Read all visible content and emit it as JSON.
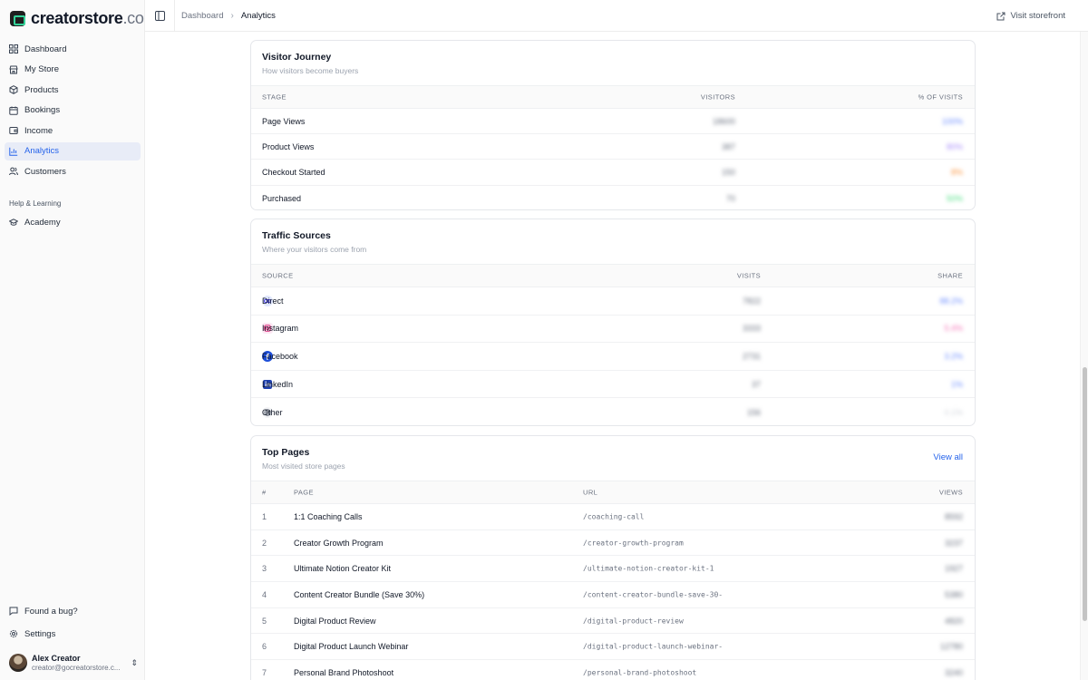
{
  "app": {
    "logo_main": "creatorstore",
    "logo_suffix": ".co"
  },
  "sidebar": {
    "items": [
      {
        "label": "Dashboard",
        "icon": "grid-icon"
      },
      {
        "label": "My Store",
        "icon": "store-icon"
      },
      {
        "label": "Products",
        "icon": "box-icon"
      },
      {
        "label": "Bookings",
        "icon": "calendar-icon"
      },
      {
        "label": "Income",
        "icon": "wallet-icon"
      },
      {
        "label": "Analytics",
        "icon": "bar-chart-icon",
        "active": true
      },
      {
        "label": "Customers",
        "icon": "users-icon"
      }
    ],
    "section_label": "Help & Learning",
    "help_items": [
      {
        "label": "Academy",
        "icon": "graduation-cap-icon"
      }
    ],
    "bottom_items": [
      {
        "label": "Found a bug?",
        "icon": "chat-icon"
      },
      {
        "label": "Settings",
        "icon": "gear-icon"
      }
    ],
    "user": {
      "name": "Alex Creator",
      "email": "creator@gocreatorstore.c..."
    }
  },
  "topbar": {
    "breadcrumb": [
      "Dashboard",
      "Analytics"
    ],
    "visit_label": "Visit storefront"
  },
  "visitor_journey": {
    "title": "Visitor Journey",
    "subtitle": "How visitors become buyers",
    "columns": [
      "STAGE",
      "VISITORS",
      "% OF VISITS"
    ],
    "rows": [
      {
        "stage": "Page Views",
        "visitors": "18600",
        "pct": "100%",
        "color": "#6b8cff"
      },
      {
        "stage": "Product Views",
        "visitors": "387",
        "pct": "80%",
        "color": "#a78bfa"
      },
      {
        "stage": "Checkout Started",
        "visitors": "150",
        "pct": "8%",
        "color": "#fb923c"
      },
      {
        "stage": "Purchased",
        "visitors": "70",
        "pct": "50%",
        "color": "#4ade80"
      }
    ]
  },
  "traffic_sources": {
    "title": "Traffic Sources",
    "subtitle": "Where your visitors come from",
    "columns": [
      "SOURCE",
      "VISITS",
      "SHARE"
    ],
    "rows": [
      {
        "source": "Direct",
        "icon": "link-icon",
        "visits": "7822",
        "share": "88.2%",
        "color": "#6b8cff"
      },
      {
        "source": "Instagram",
        "icon": "instagram-icon",
        "visits": "3333",
        "share": "5.4%",
        "color": "#f472b6"
      },
      {
        "source": "Facebook",
        "icon": "facebook-icon",
        "visits": "2731",
        "share": "3.2%",
        "color": "#6b8cff"
      },
      {
        "source": "LinkedIn",
        "icon": "linkedin-icon",
        "visits": "37",
        "share": "1%",
        "color": "#6b8cff"
      },
      {
        "source": "Other",
        "icon": "globe-icon",
        "visits": "156",
        "share": "0.1%",
        "color": "#d1d5db"
      }
    ]
  },
  "top_pages": {
    "title": "Top Pages",
    "subtitle": "Most visited store pages",
    "view_all": "View all",
    "columns": [
      "#",
      "PAGE",
      "URL",
      "VIEWS"
    ],
    "rows": [
      {
        "rank": "1",
        "page": "1:1 Coaching Calls",
        "url": "/coaching-call",
        "views": "8592"
      },
      {
        "rank": "2",
        "page": "Creator Growth Program",
        "url": "/creator-growth-program",
        "views": "3237"
      },
      {
        "rank": "3",
        "page": "Ultimate Notion Creator Kit",
        "url": "/ultimate-notion-creator-kit-1",
        "views": "1927"
      },
      {
        "rank": "4",
        "page": "Content Creator Bundle (Save 30%)",
        "url": "/content-creator-bundle-save-30-",
        "views": "5380"
      },
      {
        "rank": "5",
        "page": "Digital Product Review",
        "url": "/digital-product-review",
        "views": "4820"
      },
      {
        "rank": "6",
        "page": "Digital Product Launch Webinar",
        "url": "/digital-product-launch-webinar-",
        "views": "12780"
      },
      {
        "rank": "7",
        "page": "Personal Brand Photoshoot",
        "url": "/personal-brand-photoshoot",
        "views": "3240"
      }
    ]
  }
}
